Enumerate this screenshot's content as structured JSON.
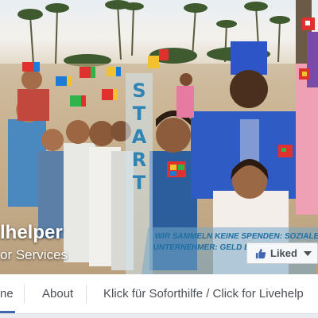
{
  "cover": {
    "start_letters": [
      "S",
      "T",
      "A",
      "R",
      "T"
    ],
    "slogan_lines": [
      "WIR SAMMELN KEINE SPENDEN: SOZIALE",
      "UNTERNEHMER: GELD BESCHAFFEN, GUTES TUN"
    ]
  },
  "page": {
    "name": "lhelper",
    "category": "or Services"
  },
  "like_button": {
    "label": "Liked",
    "icon": "thumbs-up-icon"
  },
  "tabs": [
    {
      "label": "ne",
      "active": true
    },
    {
      "label": "About",
      "active": false
    },
    {
      "label": "Klick für Soforthilfe / Click for Livehelp",
      "active": false
    }
  ],
  "colors": {
    "accent": "#4267b2",
    "like_blue": "#4267b2",
    "banner_text": "#2f84b4"
  }
}
